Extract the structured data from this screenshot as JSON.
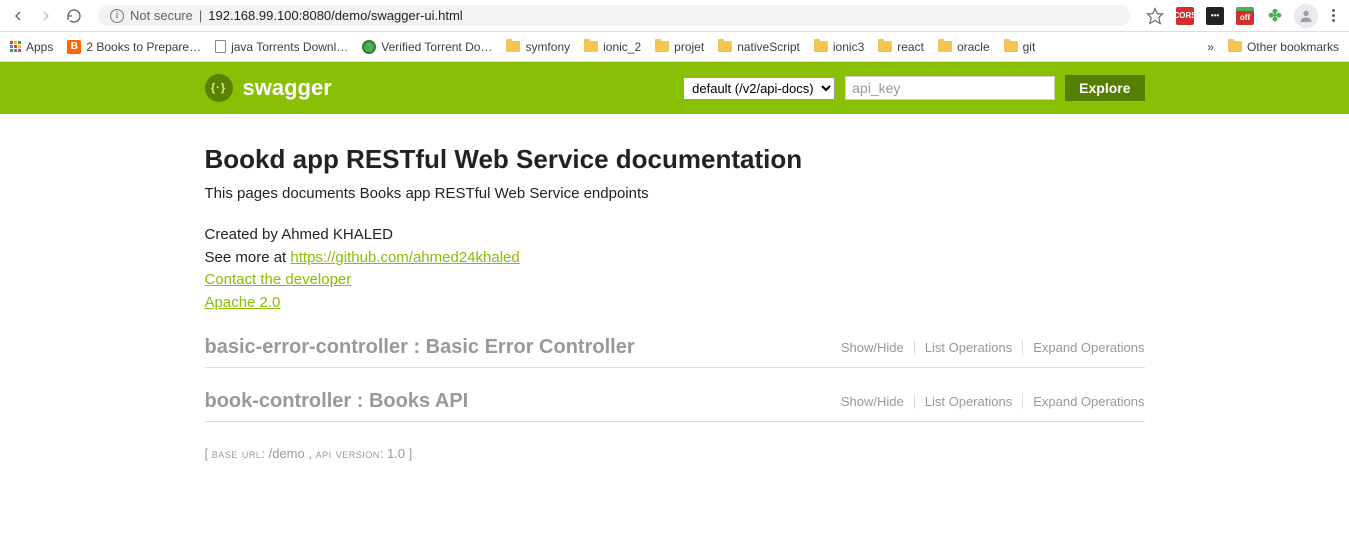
{
  "browser": {
    "not_secure": "Not secure",
    "url": "192.168.99.100:8080/demo/swagger-ui.html",
    "url_port": ":8080",
    "other_bookmarks": "Other bookmarks"
  },
  "bookmarks": {
    "apps": "Apps",
    "items": [
      "2 Books to Prepare…",
      "java Torrents Downl…",
      "Verified Torrent Do…",
      "symfony",
      "ionic_2",
      "projet",
      "nativeScript",
      "ionic3",
      "react",
      "oracle",
      "git"
    ]
  },
  "swagger": {
    "brand": "swagger",
    "select_value": "default (/v2/api-docs)",
    "api_key_placeholder": "api_key",
    "explore": "Explore"
  },
  "api": {
    "title": "Bookd app RESTful Web Service documentation",
    "description": "This pages documents Books app RESTful Web Service endpoints",
    "created_by": "Created by Ahmed KHALED",
    "see_more_prefix": "See more at ",
    "see_more_link": "https://github.com/ahmed24khaled",
    "contact_link": "Contact the developer",
    "license_link": "Apache 2.0"
  },
  "controllers": [
    {
      "name": "basic-error-controller : Basic Error Controller"
    },
    {
      "name": "book-controller : Books API"
    }
  ],
  "controller_actions": {
    "show_hide": "Show/Hide",
    "list_ops": "List Operations",
    "expand_ops": "Expand Operations"
  },
  "footer": {
    "base_url_label": "base url",
    "base_url_value": ": /demo ,",
    "api_version_label": "api version",
    "api_version_value": ": 1.0"
  }
}
